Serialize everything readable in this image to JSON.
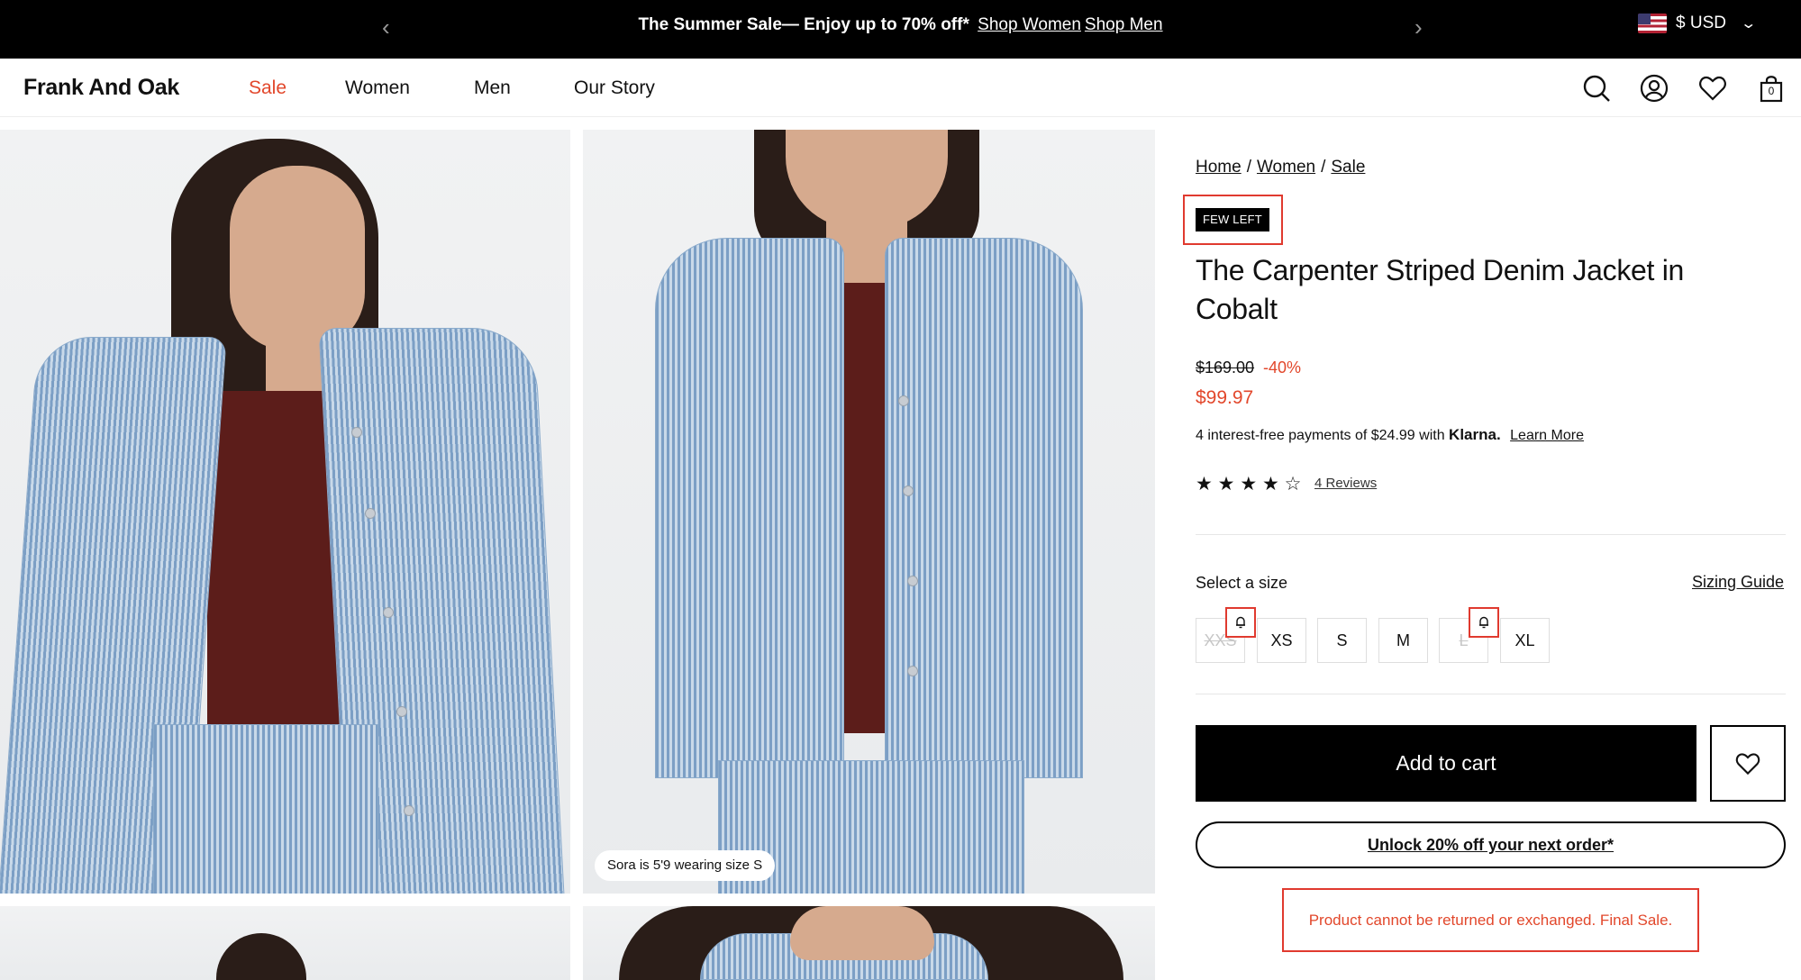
{
  "announcement": {
    "text": "The Summer Sale— Enjoy up to 70% off*",
    "link_women": "Shop Women",
    "link_men": "Shop Men",
    "prev_icon": "chevron-left-icon",
    "next_icon": "chevron-right-icon"
  },
  "currency": {
    "label": "$ USD",
    "flag_icon": "us-flag-icon"
  },
  "header": {
    "logo": "Frank And Oak",
    "nav": [
      "Sale",
      "Women",
      "Men",
      "Our Story"
    ],
    "bag_count": "0",
    "icons": [
      "search-icon",
      "account-icon",
      "heart-icon",
      "bag-icon"
    ]
  },
  "gallery": {
    "caption": "Sora is 5'9 wearing size S"
  },
  "breadcrumb": [
    "Home",
    "Women",
    "Sale"
  ],
  "badge": "FEW LEFT",
  "product": {
    "title": "The Carpenter Striped Denim Jacket in Cobalt",
    "old_price": "$169.00",
    "discount": "-40%",
    "price": "$99.97",
    "klarna_text": "4 interest-free payments of $24.99 with",
    "klarna_brand": "Klarna.",
    "klarna_link": "Learn More",
    "rating": 4,
    "rating_max": 5,
    "stars": "★ ★ ★ ★ ☆",
    "reviews": "4 Reviews"
  },
  "sizes": {
    "label": "Select a size",
    "guide": "Sizing Guide",
    "options": [
      "XXS",
      "XS",
      "S",
      "M",
      "L",
      "XL"
    ],
    "unavailable": [
      "XXS",
      "L"
    ]
  },
  "actions": {
    "add_to_cart": "Add to cart",
    "unlock": "Unlock 20% off your next order*",
    "final_sale": "Product cannot be returned or exchanged. Final Sale."
  },
  "colors": {
    "sale_red": "#e2472b",
    "highlight_red": "#e03a2f",
    "black": "#000000"
  }
}
